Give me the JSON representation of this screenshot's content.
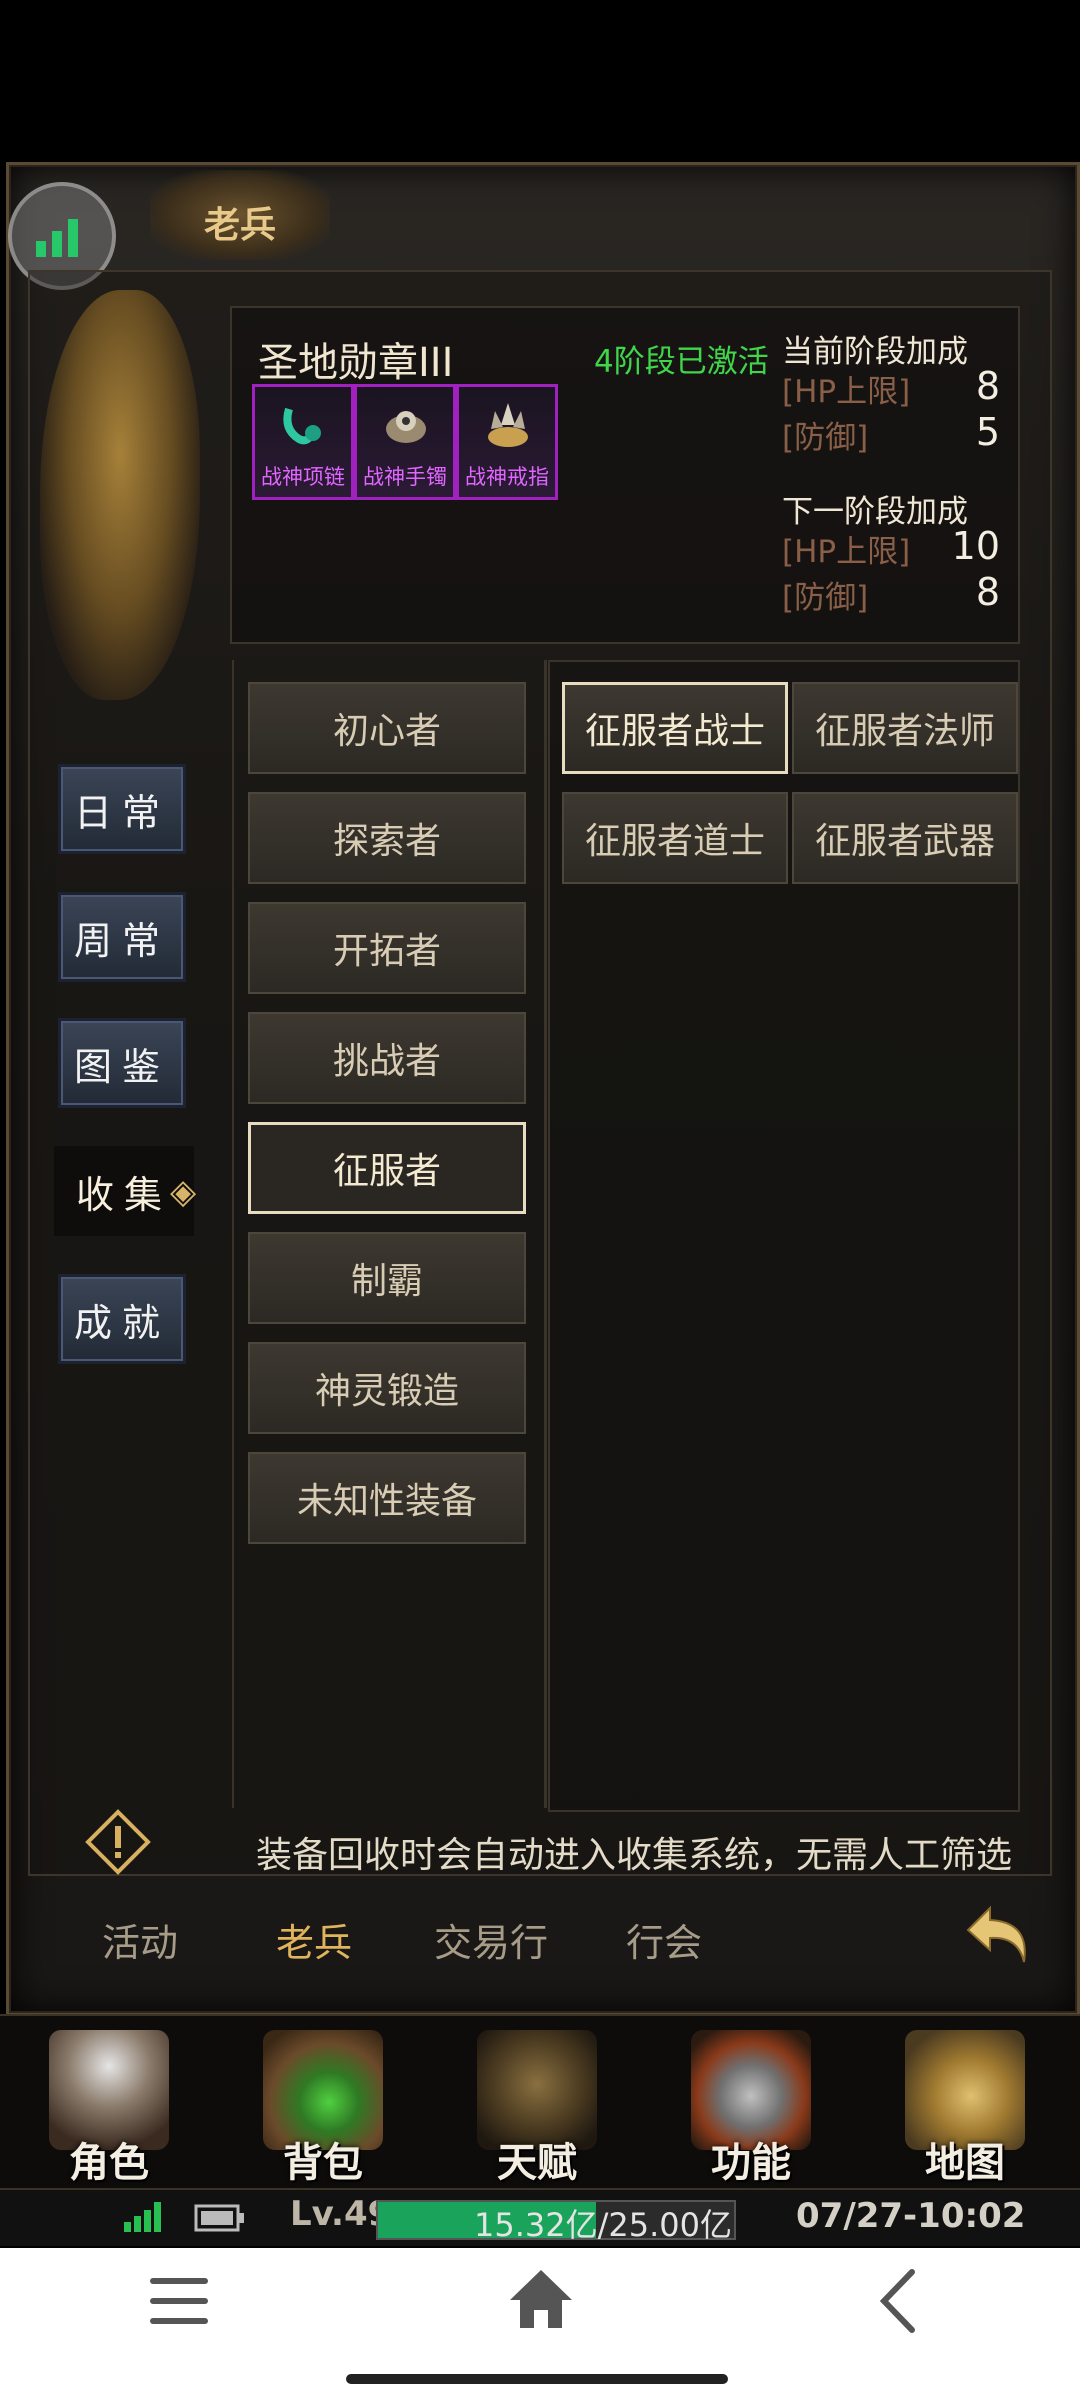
{
  "window": {
    "title": "老兵"
  },
  "info": {
    "medal_name": "圣地勋章III",
    "stage_status": "4阶段已激活",
    "items": [
      {
        "label": "战神项链",
        "icon": "necklace-icon",
        "color": "#2ec7a0"
      },
      {
        "label": "战神手镯",
        "icon": "bracelet-icon",
        "color": "#c8b898"
      },
      {
        "label": "战神戒指",
        "icon": "ring-icon",
        "color": "#c8b07a"
      }
    ],
    "current_heading": "当前阶段加成",
    "current": [
      {
        "name": "[HP上限]",
        "value": "8"
      },
      {
        "name": "[防御]",
        "value": "5"
      }
    ],
    "next_heading": "下一阶段加成",
    "next": [
      {
        "name": "[HP上限]",
        "value": "10"
      },
      {
        "name": "[防御]",
        "value": "8"
      }
    ]
  },
  "side_nav": [
    "日常",
    "周常",
    "图鉴",
    "收集",
    "成就"
  ],
  "side_nav_active": "收集",
  "categories": [
    "初心者",
    "探索者",
    "开拓者",
    "挑战者",
    "征服者",
    "制霸",
    "神灵锻造",
    "未知性装备"
  ],
  "category_active": "征服者",
  "subcategories": [
    "征服者战士",
    "征服者法师",
    "征服者道士",
    "征服者武器"
  ],
  "subcategory_active": "征服者战士",
  "tip": "装备回收时会自动进入收集系统，无需人工筛选",
  "bottom_tabs": [
    "活动",
    "老兵",
    "交易行",
    "行会"
  ],
  "bottom_tab_active": "老兵",
  "menu": [
    "角色",
    "背包",
    "天赋",
    "功能",
    "地图"
  ],
  "status": {
    "level": "Lv.49",
    "exp_text": "15.32亿/25.00亿",
    "exp_fraction": 0.613,
    "clock": "07/27-10:02"
  }
}
